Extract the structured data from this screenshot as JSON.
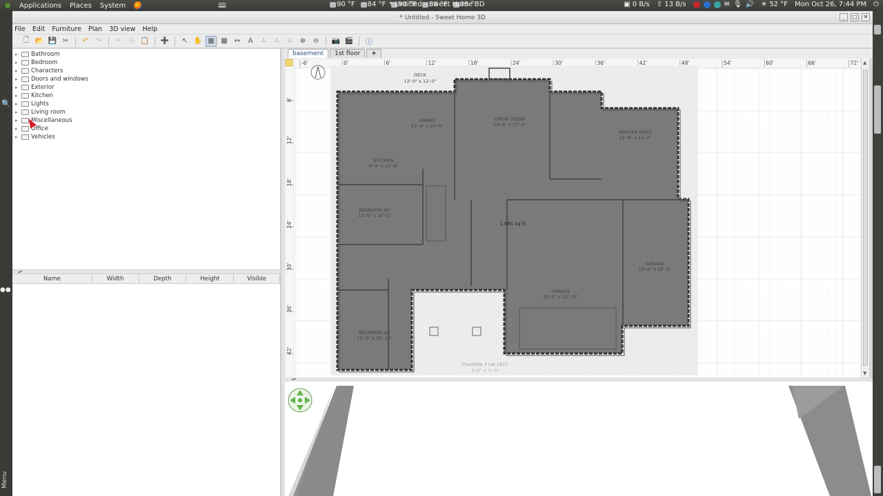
{
  "system_panel": {
    "menus": [
      "Applications",
      "Places",
      "System"
    ],
    "weather": [
      "90 °F",
      "84 °F",
      "90 °F",
      "88 °F",
      "88 °F"
    ],
    "net_down": "0 B/s",
    "net_up": "13 B/s",
    "temperature": "52 °F",
    "clock": "Mon Oct 26,  7:44 PM"
  },
  "window": {
    "title": "* Untitled - Sweet Home 3D"
  },
  "menubar": [
    "File",
    "Edit",
    "Furniture",
    "Plan",
    "3D view",
    "Help"
  ],
  "catalog": {
    "categories": [
      "Bathroom",
      "Bedroom",
      "Characters",
      "Doors and windows",
      "Exterior",
      "Kitchen",
      "Lights",
      "Living room",
      "Miscellaneous",
      "Office",
      "Vehicles"
    ]
  },
  "furniture_table": {
    "columns": [
      "Name",
      "Width",
      "Depth",
      "Height",
      "Visible"
    ]
  },
  "plan_tabs": {
    "levels": [
      "basement",
      "1st floor"
    ],
    "add_label": "+"
  },
  "plan": {
    "ruler_x": [
      "-6'",
      "0'",
      "6'",
      "12'",
      "18'",
      "24'",
      "30'",
      "36'",
      "42'",
      "48'",
      "54'",
      "60'",
      "66'",
      "72'"
    ],
    "ruler_y": [
      "6'",
      "12'",
      "18'",
      "24'",
      "30'",
      "36'",
      "42'"
    ],
    "area_label": "1,681 sq ft",
    "rooms": [
      {
        "name": "DECK",
        "size": "12'-0\" x 12'-0\""
      },
      {
        "name": "DINING",
        "size": "11'-4\" x 10'-0\""
      },
      {
        "name": "GREAT ROOM",
        "size": "16'-0\" x 17'-3\""
      },
      {
        "name": "MASTER SUITE",
        "size": "15'-8\" x 15'-2\""
      },
      {
        "name": "KITCHEN",
        "size": "9'-4\" x 10'-6\""
      },
      {
        "name": "BEDROOM #1",
        "size": "12'-5\" x 10'-1\""
      },
      {
        "name": "GARAGE",
        "size": "12'-0\" x 22'-0\""
      },
      {
        "name": "GARAGE",
        "size": "20'-0\" x 21'-10\""
      },
      {
        "name": "BEDROOM #2",
        "size": "12'-0\" x 10'-10\""
      }
    ],
    "caption": "Charlotte 3 car 1817",
    "caption_sub": "3'-0\" = 1'-0\""
  },
  "sidebar_menu_label": "Menu"
}
